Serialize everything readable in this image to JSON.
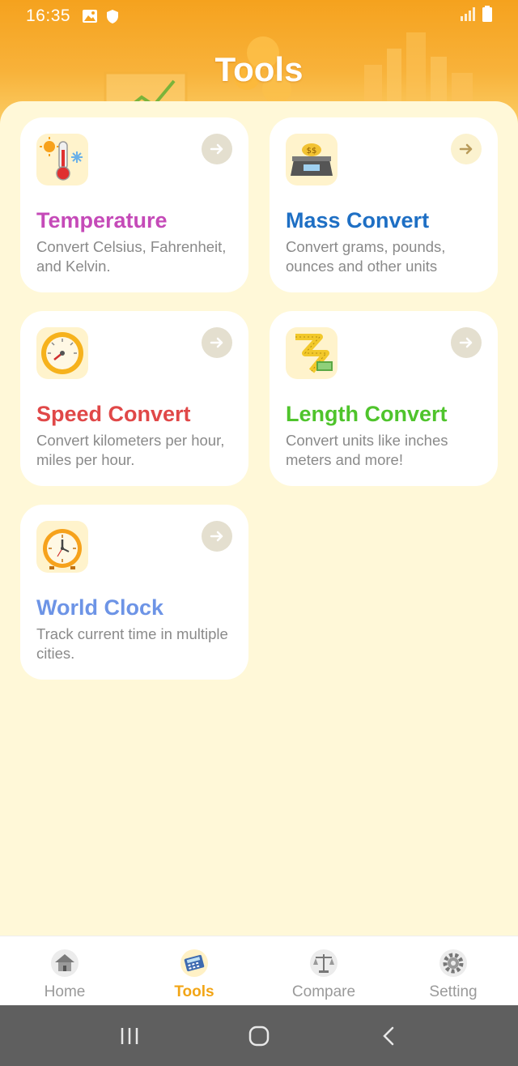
{
  "status_bar": {
    "time": "16:35"
  },
  "header": {
    "title": "Tools"
  },
  "cards": [
    {
      "title": "Temperature",
      "description": "Convert Celsius, Fahrenheit, and Kelvin.",
      "icon": "thermometer-icon",
      "color": "#c54ab8"
    },
    {
      "title": "Mass Convert",
      "description": "Convert grams, pounds, ounces and other units",
      "icon": "scale-icon",
      "color": "#1e6fc4"
    },
    {
      "title": "Speed Convert",
      "description": "Convert kilometers per hour, miles per hour.",
      "icon": "speedometer-icon",
      "color": "#e04848"
    },
    {
      "title": "Length Convert",
      "description": "Convert units like inches meters and more!",
      "icon": "tape-measure-icon",
      "color": "#4fc42c"
    },
    {
      "title": "World Clock",
      "description": "Track current time in multiple cities.",
      "icon": "clock-icon",
      "color": "#6d94e6"
    }
  ],
  "bottom_nav": {
    "items": [
      {
        "label": "Home",
        "icon": "home-icon"
      },
      {
        "label": "Tools",
        "icon": "calculator-icon",
        "active": true
      },
      {
        "label": "Compare",
        "icon": "balance-icon"
      },
      {
        "label": "Setting",
        "icon": "gear-icon"
      }
    ]
  },
  "colors": {
    "header": "#f5a21e",
    "background": "#fff8d8",
    "active_nav": "#f2a516"
  }
}
